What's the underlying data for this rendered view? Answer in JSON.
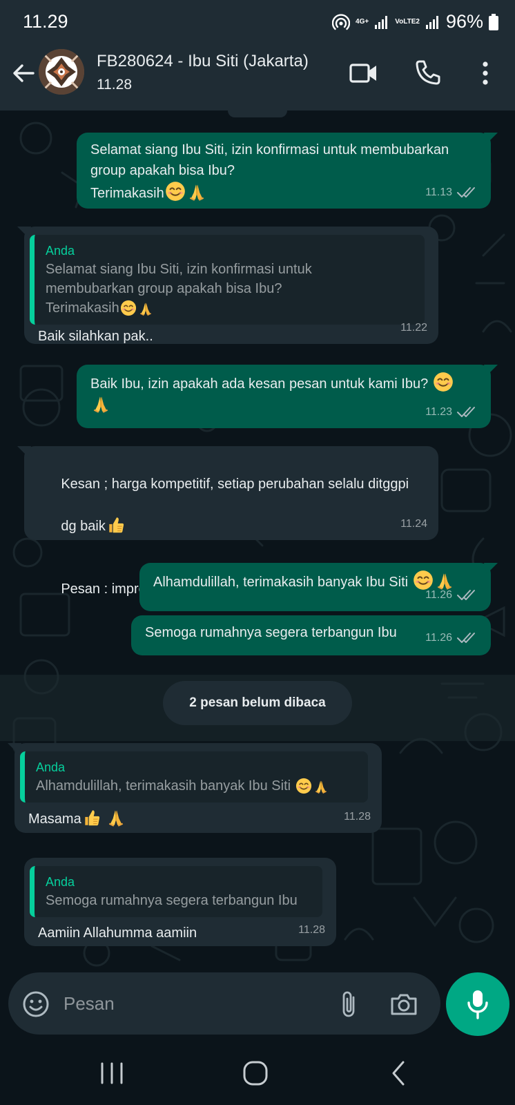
{
  "status_bar": {
    "time": "11.29",
    "network_top": "4G+",
    "network_bottom": "VoLTE2",
    "battery": "96%"
  },
  "header": {
    "contact_name": "FB280624 - Ibu Siti (Jakarta)",
    "last_seen": "11.28"
  },
  "messages": [
    {
      "direction": "out",
      "text": "Selamat siang Ibu Siti, izin konfirmasi untuk membubarkan\ngroup apakah bisa Ibu?\nTerimakasih",
      "emojis": [
        "smiling-face",
        "folded-hands"
      ],
      "time": "11.13",
      "status": "read"
    },
    {
      "direction": "in",
      "quote_author": "Anda",
      "quote_text": "Selamat siang Ibu Siti, izin konfirmasi untuk\nmembubarkan group apakah bisa Ibu?\nTerimakasih",
      "text": "Baik silahkan pak..",
      "time": "11.22"
    },
    {
      "direction": "out",
      "text": "Baik Ibu, izin apakah ada kesan pesan untuk kami Ibu?",
      "emojis": [
        "smiling-face",
        "folded-hands"
      ],
      "time": "11.23",
      "status": "read"
    },
    {
      "direction": "in",
      "text_line1": "Kesan ; harga kompetitif, setiap perubahan selalu ditggpi",
      "text_line2": "dg baik",
      "text_line3": "Pesan : improvement utk kelengkapan mep",
      "emojis": [
        "thumbs-up",
        "thumbs-up"
      ],
      "time": "11.24"
    },
    {
      "direction": "out",
      "text": "Alhamdulillah, terimakasih banyak Ibu Siti",
      "emojis": [
        "smiling-face",
        "folded-hands"
      ],
      "time": "11.26",
      "status": "read"
    },
    {
      "direction": "out",
      "text": "Semoga rumahnya segera terbangun Ibu",
      "time": "11.26",
      "status": "read"
    },
    {
      "direction": "in",
      "quote_author": "Anda",
      "quote_text": "Alhamdulillah, terimakasih banyak Ibu Siti",
      "text": "Masama",
      "emojis": [
        "thumbs-up",
        "folded-hands"
      ],
      "time": "11.28"
    },
    {
      "direction": "in",
      "quote_author": "Anda",
      "quote_text": "Semoga rumahnya segera terbangun Ibu",
      "text": "Aamiin Allahumma aamiin",
      "time": "11.28"
    }
  ],
  "unread_banner": "2 pesan belum dibaca",
  "composer": {
    "placeholder": "Pesan"
  },
  "icons": [
    "back-arrow-icon",
    "video-call-icon",
    "phone-icon",
    "more-options-icon",
    "emoji-icon",
    "attach-icon",
    "camera-icon",
    "mic-icon"
  ],
  "colors": {
    "outgoing_bubble": "#005c4b",
    "incoming_bubble": "#1f2c34",
    "accent": "#00a884",
    "quote_bar": "#06cf9c",
    "background": "#0b141a"
  }
}
